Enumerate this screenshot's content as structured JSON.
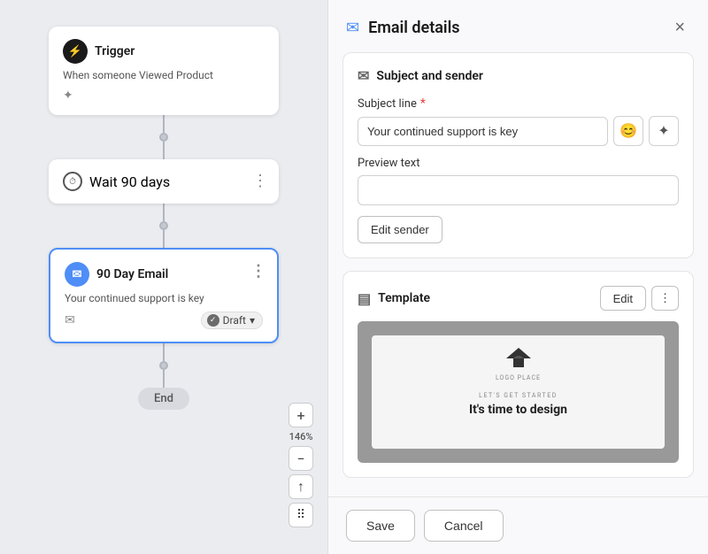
{
  "canvas": {
    "trigger": {
      "label": "Trigger",
      "description": "When someone Viewed Product"
    },
    "wait": {
      "label": "Wait 90 days"
    },
    "email_node": {
      "label": "90 Day Email",
      "description": "Your continued support is key",
      "status": "Draft"
    },
    "end": {
      "label": "End"
    },
    "zoom": {
      "level": "146%",
      "plus": "+",
      "minus": "−",
      "up": "↑"
    }
  },
  "panel": {
    "title": "Email details",
    "close_label": "×",
    "subject_section": {
      "title": "Subject and sender",
      "subject_label": "Subject line",
      "subject_value": "Your continued support is key",
      "subject_placeholder": "Your continued support is key",
      "preview_label": "Preview text",
      "preview_placeholder": "",
      "emoji_icon": "😊",
      "sparkle_icon": "✦",
      "edit_sender_label": "Edit sender"
    },
    "template_section": {
      "title": "Template",
      "edit_label": "Edit",
      "more_icon": "⋮",
      "email_preview": {
        "logo_text": "LOGO PLACE",
        "tagline": "LET'S GET STARTED",
        "headline": "It's time to design"
      }
    },
    "footer": {
      "save_label": "Save",
      "cancel_label": "Cancel"
    }
  }
}
